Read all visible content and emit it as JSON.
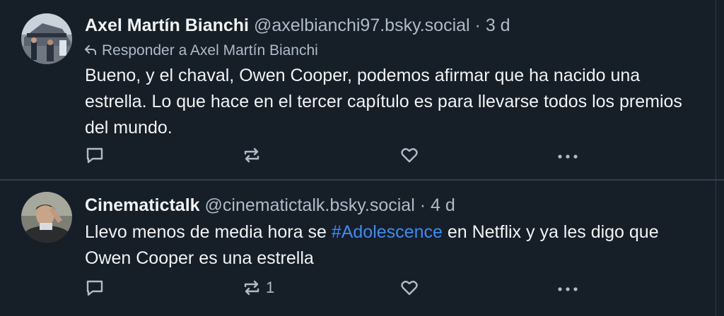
{
  "posts": [
    {
      "author_name": "Axel Martín Bianchi",
      "handle": "@axelbianchi97.bsky.social",
      "separator": "·",
      "time": "3 d",
      "reply_context": "Responder a Axel Martín Bianchi",
      "text": "Bueno, y el chaval, Owen Cooper, podemos afirmar que ha nacido una estrella. Lo que hace en el tercer capítulo es para llevarse todos los premios del mundo.",
      "actions": {
        "reply_icon": "comment-icon",
        "repost_icon": "repost-icon",
        "repost_count": "",
        "like_icon": "heart-icon",
        "more_icon": "more-icon"
      }
    },
    {
      "author_name": "Cinematictalk",
      "handle": "@cinematictalk.bsky.social",
      "separator": "·",
      "time": "4 d",
      "text_before": "Llevo menos de media hora se ",
      "hashtag": "#Adolescence",
      "text_after": " en Netflix y ya les digo que Owen Cooper es una estrella",
      "actions": {
        "reply_icon": "comment-icon",
        "repost_icon": "repost-icon",
        "repost_count": "1",
        "like_icon": "heart-icon",
        "more_icon": "more-icon"
      }
    }
  ],
  "colors": {
    "background": "#161e27",
    "text": "#f1f3f5",
    "muted": "#aebbc9",
    "link": "#3d8bf5",
    "divider": "#2e4052"
  }
}
